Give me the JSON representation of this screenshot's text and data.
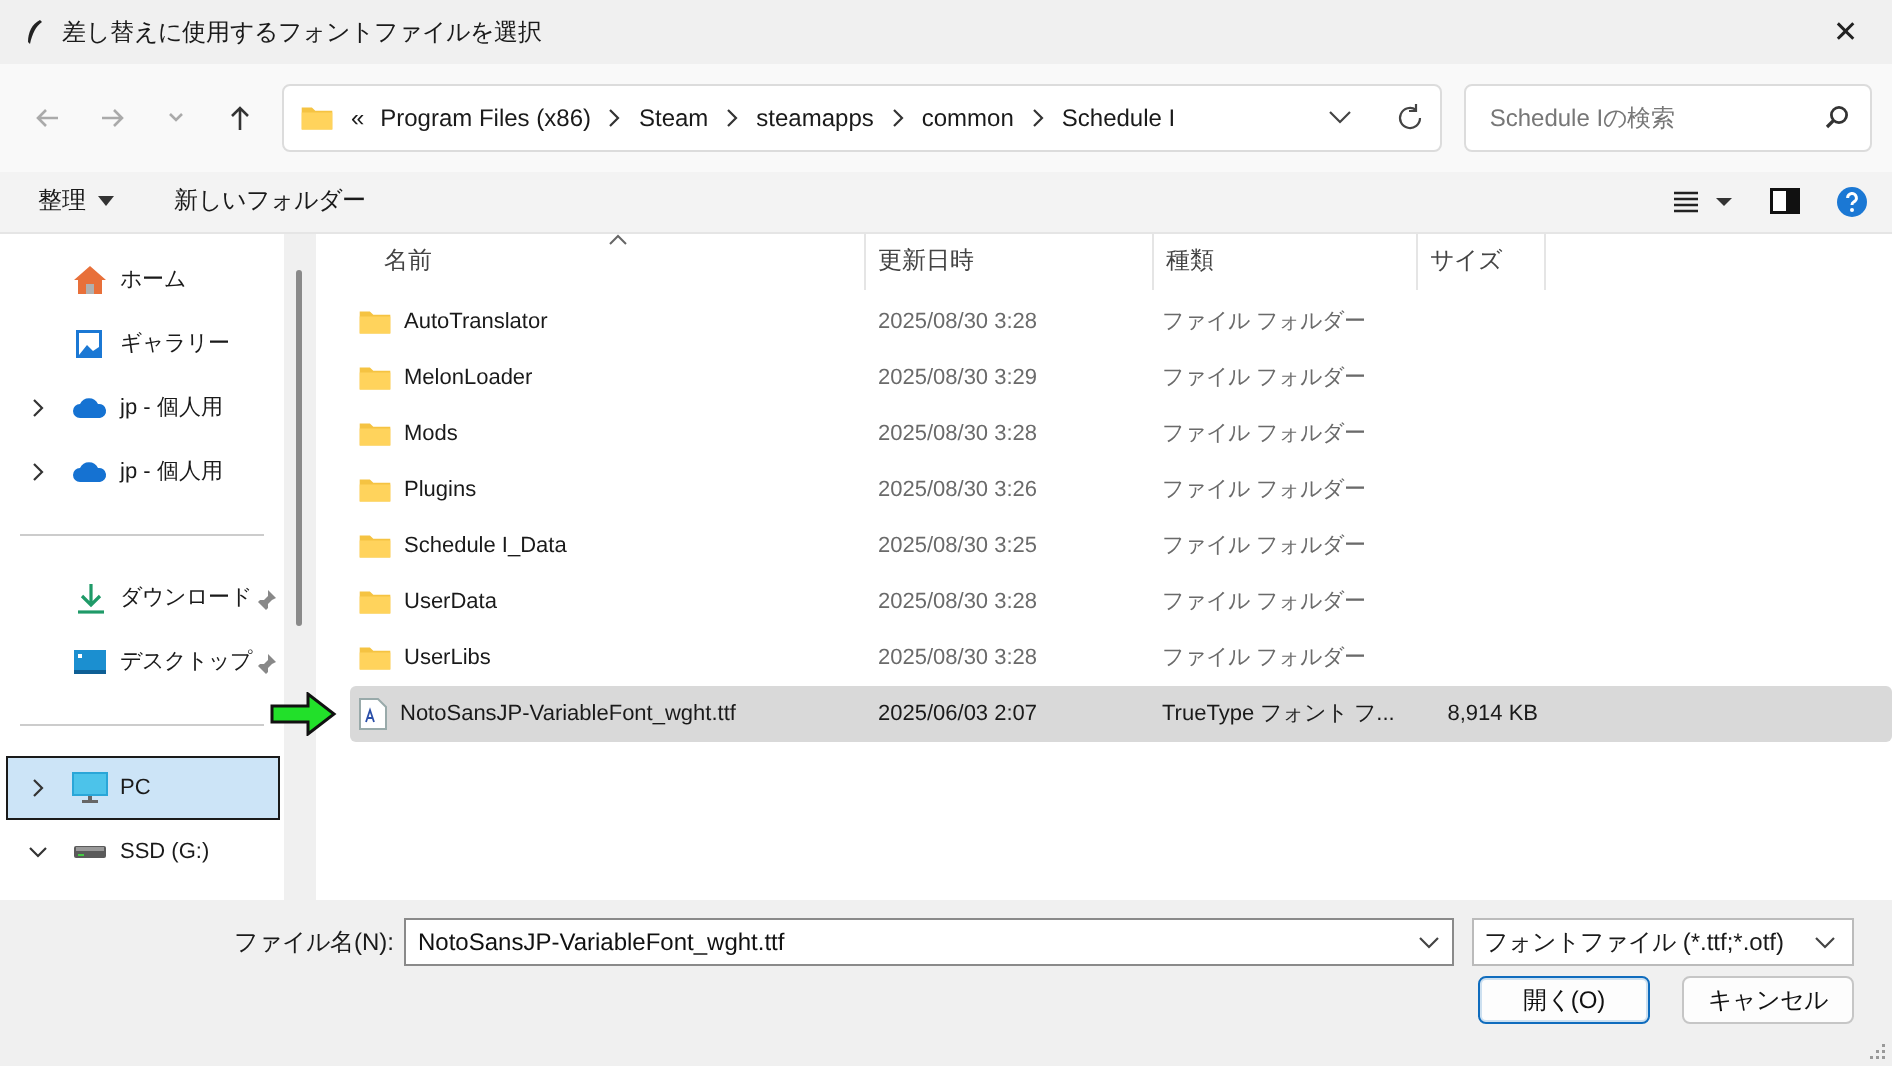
{
  "window": {
    "title": "差し替えに使用するフォントファイルを選択",
    "close": "✕"
  },
  "nav": [
    {
      "kind": "back",
      "disabled": true
    },
    {
      "kind": "forward",
      "disabled": true
    },
    {
      "kind": "recent",
      "disabled": true
    },
    {
      "kind": "up",
      "disabled": false
    }
  ],
  "address": {
    "overflow_mark": "«",
    "path": [
      "Program Files (x86)",
      "Steam",
      "steamapps",
      "common",
      "Schedule I"
    ]
  },
  "search": {
    "placeholder": "Schedule Iの検索"
  },
  "toolbar": {
    "organize": "整理",
    "new_folder": "新しいフォルダー"
  },
  "sidebar": {
    "sections": [
      [
        {
          "kind": "home",
          "label": "ホーム",
          "pinned": false,
          "selected": false
        },
        {
          "kind": "gallery",
          "label": "ギャラリー",
          "pinned": false,
          "selected": false
        },
        {
          "kind": "cloud",
          "label": "jp - 個人用",
          "expanded": false,
          "pinned": false,
          "selected": false
        },
        {
          "kind": "cloud",
          "label": "jp - 個人用",
          "expanded": false,
          "pinned": false,
          "selected": false
        }
      ],
      [
        {
          "kind": "download",
          "label": "ダウンロード",
          "pinned": true,
          "selected": false
        },
        {
          "kind": "desktop",
          "label": "デスクトップ",
          "pinned": true,
          "selected": false
        }
      ],
      [
        {
          "kind": "pc",
          "label": "PC",
          "expanded": false,
          "pinned": false,
          "selected": true
        },
        {
          "kind": "drive",
          "label": "SSD (G:)",
          "expanded": true,
          "pinned": false,
          "selected": false
        }
      ]
    ]
  },
  "table": {
    "columns": [
      {
        "label": "名前",
        "sorted": true
      },
      {
        "label": "更新日時",
        "sorted": false
      },
      {
        "label": "種類",
        "sorted": false
      },
      {
        "label": "サイズ",
        "sorted": false
      }
    ],
    "rows": [
      {
        "kind": "folder",
        "name": "AutoTranslator",
        "modified": "2025/08/30 3:28",
        "type": "ファイル フォルダー",
        "selected": false,
        "pointer": false
      },
      {
        "kind": "folder",
        "name": "MelonLoader",
        "modified": "2025/08/30 3:29",
        "type": "ファイル フォルダー",
        "selected": false,
        "pointer": false
      },
      {
        "kind": "folder",
        "name": "Mods",
        "modified": "2025/08/30 3:28",
        "type": "ファイル フォルダー",
        "selected": false,
        "pointer": false
      },
      {
        "kind": "folder",
        "name": "Plugins",
        "modified": "2025/08/30 3:26",
        "type": "ファイル フォルダー",
        "selected": false,
        "pointer": false
      },
      {
        "kind": "folder",
        "name": "Schedule I_Data",
        "modified": "2025/08/30 3:25",
        "type": "ファイル フォルダー",
        "selected": false,
        "pointer": false
      },
      {
        "kind": "folder",
        "name": "UserData",
        "modified": "2025/08/30 3:28",
        "type": "ファイル フォルダー",
        "selected": false,
        "pointer": false
      },
      {
        "kind": "folder",
        "name": "UserLibs",
        "modified": "2025/08/30 3:28",
        "type": "ファイル フォルダー",
        "selected": false,
        "pointer": false
      },
      {
        "kind": "font",
        "name": "NotoSansJP-VariableFont_wght.ttf",
        "modified": "2025/06/03 2:07",
        "type": "TrueType フォント フ...",
        "size": "8,914 KB",
        "selected": true,
        "pointer": true
      }
    ]
  },
  "footer": {
    "filename_label": "ファイル名(N):",
    "filename": "NotoSansJP-VariableFont_wght.ttf",
    "filter": "フォントファイル (*.ttf;*.otf)",
    "buttons": [
      {
        "kind": "primary",
        "label": "開く(O)"
      },
      {
        "kind": "normal",
        "label": "キャンセル"
      }
    ]
  }
}
